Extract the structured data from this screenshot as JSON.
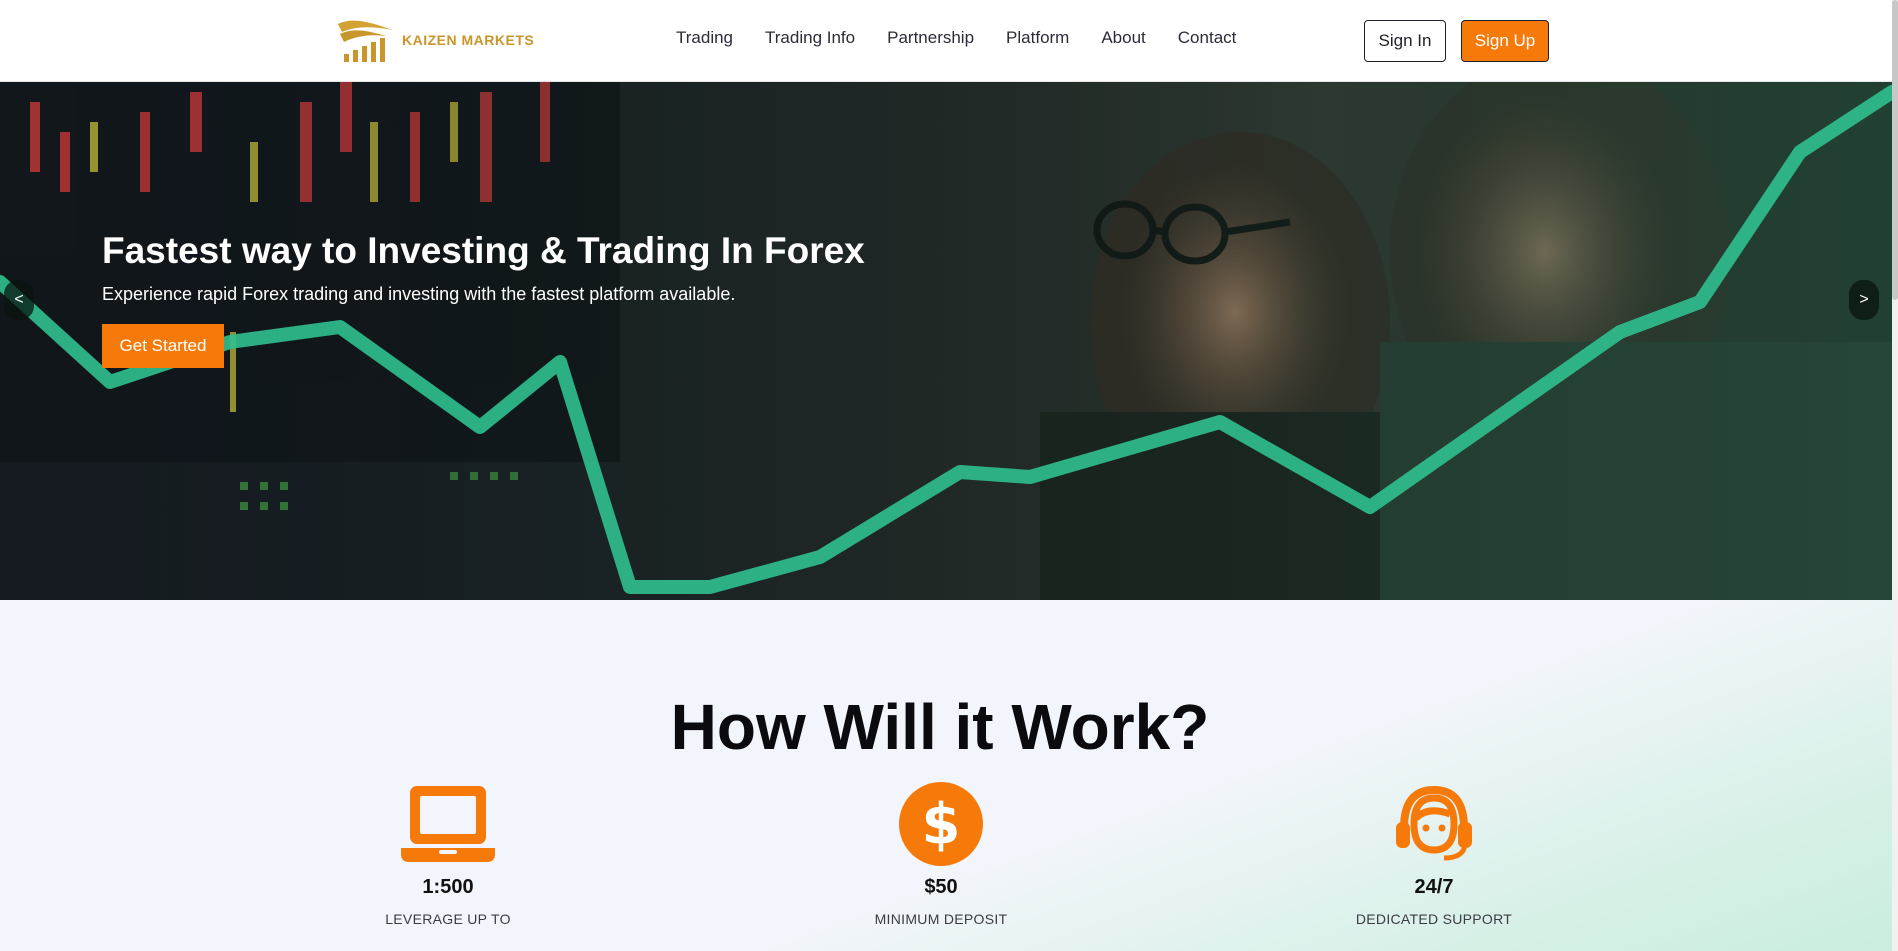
{
  "header": {
    "logo_text": "KAIZEN MARKETS",
    "nav": [
      "Trading",
      "Trading Info",
      "Partnership",
      "Platform",
      "About",
      "Contact"
    ],
    "signin_label": "Sign In",
    "signup_label": "Sign Up"
  },
  "hero": {
    "title": "Fastest way to Investing & Trading In Forex",
    "subtitle": "Experience rapid Forex trading and investing with the fastest platform available.",
    "cta_label": "Get Started",
    "prev_label": "<",
    "next_label": ">"
  },
  "how": {
    "title": "How Will it Work?",
    "features": [
      {
        "icon": "laptop-icon",
        "value": "1:500",
        "label": "LEVERAGE UP TO"
      },
      {
        "icon": "dollar-icon",
        "value": "$50",
        "label": "MINIMUM DEPOSIT"
      },
      {
        "icon": "headset-support-icon",
        "value": "24/7",
        "label": "DEDICATED SUPPORT"
      }
    ]
  },
  "colors": {
    "accent": "#f57a0a",
    "logo_gold": "#c9962b",
    "trend_line": "#2fc08f"
  }
}
